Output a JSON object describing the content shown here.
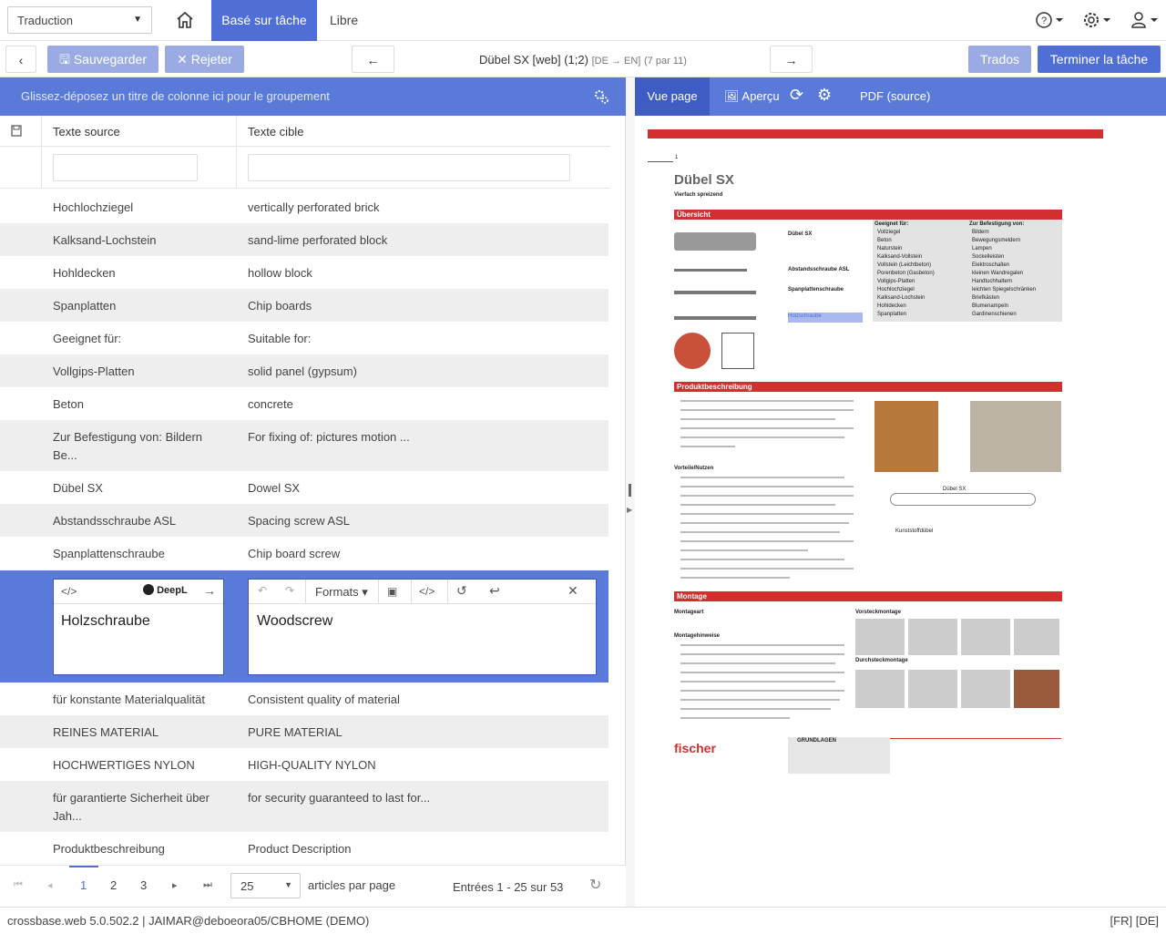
{
  "topbar": {
    "mode_select": "Traduction",
    "tab_task": "Basé sur tâche",
    "tab_free": "Libre"
  },
  "toolbar": {
    "save": "Sauvegarder",
    "reject": "Rejeter",
    "doc_title": "Dübel SX [web] (1;2)",
    "doc_lang": "[DE → EN]",
    "doc_pos": "(7 par 11)",
    "trados": "Trados",
    "finish": "Terminer la tâche"
  },
  "grid": {
    "group_hint": "Glissez-déposez un titre de colonne ici pour le groupement",
    "col_source": "Texte source",
    "col_target": "Texte cible",
    "rows": [
      {
        "src": "Hochlochziegel",
        "tgt": "vertically perforated brick"
      },
      {
        "src": "Kalksand-Lochstein",
        "tgt": "sand-lime perforated block"
      },
      {
        "src": "Hohldecken",
        "tgt": "hollow block"
      },
      {
        "src": "Spanplatten",
        "tgt": "Chip boards"
      },
      {
        "src": "Geeignet für:",
        "tgt": "Suitable for:"
      },
      {
        "src": "Vollgips-Platten",
        "tgt": "solid panel (gypsum)"
      },
      {
        "src": "Beton",
        "tgt": "concrete"
      },
      {
        "src": "Zur Befestigung von: Bildern Be...",
        "tgt": "For fixing of: pictures motion ..."
      },
      {
        "src": "Dübel SX",
        "tgt": "Dowel SX"
      },
      {
        "src": "Abstandsschraube ASL",
        "tgt": "Spacing screw ASL"
      },
      {
        "src": "Spanplattenschraube",
        "tgt": "Chip board screw"
      }
    ],
    "edit": {
      "deepl": "DeepL",
      "formats": "Formats",
      "src": "Holzschraube",
      "tgt": "Woodscrew"
    },
    "rows_after": [
      {
        "src": "für konstante Materialqualität",
        "tgt": "Consistent quality of material"
      },
      {
        "src": "REINES MATERIAL",
        "tgt": "PURE MATERIAL"
      },
      {
        "src": "HOCHWERTIGES NYLON",
        "tgt": "HIGH-QUALITY NYLON"
      },
      {
        "src": "für garantierte Sicherheit über Jah...",
        "tgt": "for security guaranteed to last for..."
      },
      {
        "src": "Produktbeschreibung",
        "tgt": "Product Description"
      }
    ]
  },
  "pager": {
    "pages": [
      "1",
      "2",
      "3"
    ],
    "current": "1",
    "page_size": "25",
    "per_page_label": "articles par page",
    "entries": "Entrées 1 - 25 sur 53"
  },
  "preview": {
    "tab_page": "Vue page",
    "tab_preview": "Aperçu",
    "tab_pdf": "PDF (source)",
    "pdf": {
      "page_num": "1",
      "title": "Dübel SX",
      "subtitle": "Vierfach spreizend",
      "section1": "Übersicht",
      "section2": "Produktbeschreibung",
      "section3": "Montage",
      "brand": "fischer",
      "label_dubel": "Dübel SX",
      "label_asl": "Abstandsschraube ASL",
      "label_span": "Spanplattenschraube",
      "label_holz": "Holzschraube",
      "suit_head": "Geeignet für:",
      "suit_items": [
        "Vollziegel",
        "Beton",
        "Naturstein",
        "Kalksand-Vollstein",
        "Vollstein (Leichtbeton)",
        "Porenbeton (Gasbeton)",
        "Vollgips-Platten",
        "Hochlochziegel",
        "Kalksand-Lochstein",
        "Hohldecken",
        "Spanplatten"
      ],
      "fix_head": "Zur Befestigung von:",
      "fix_items": [
        "Bildern",
        "Bewegungsmeldern",
        "Lampen",
        "Sockelleisten",
        "Elektroschalten",
        "kleinen Wandregalen",
        "Handtuchhaltern",
        "leichten Spiegelschränken",
        "Briefkästen",
        "Blumenampeln",
        "Gardinenschienen"
      ],
      "vorteile": "Vorteile/Nutzen",
      "montageart": "Montageart",
      "montagehinweise": "Montagehinweise",
      "vorsteck": "Vorsteckmontage",
      "durchsteck": "Durchsteckmontage",
      "kunststoff": "Kunststoffdübel",
      "grundlagen": "GRUNDLAGEN"
    }
  },
  "status": {
    "left": "crossbase.web 5.0.502.2 | JAIMAR@deboeora05/CBHOME (DEMO)",
    "right": "[FR] [DE]"
  }
}
